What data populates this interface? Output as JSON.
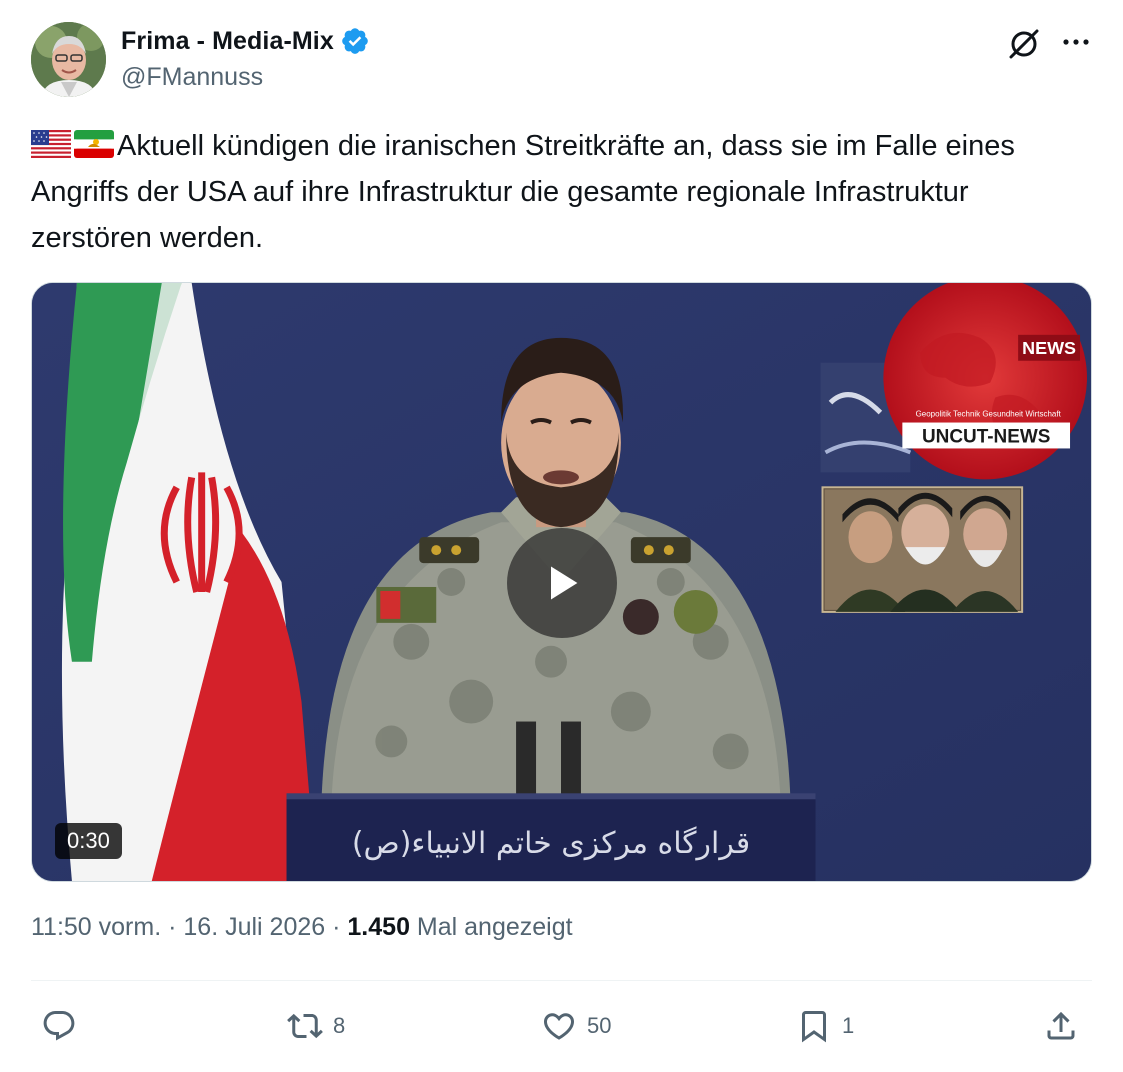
{
  "author": {
    "display_name": "Frima - Media-Mix",
    "handle": "@FMannuss",
    "verified": true,
    "verified_color": "#1d9bf0"
  },
  "header_icons": {
    "grok": "grok-icon",
    "more": "more-icon"
  },
  "tweet": {
    "flags": [
      "us-flag-icon",
      "iran-lion-sun-flag-icon"
    ],
    "text": "Aktuell kündigen die iranischen Streitkräfte an, dass sie im Falle eines Angriffs der USA auf ihre Infrastruktur die gesamte regionale Infrastruktur zerstören werden."
  },
  "media": {
    "type": "video",
    "duration": "0:30",
    "overlay_logo_badge": "NEWS",
    "overlay_logo_title": "UNCUT-NEWS",
    "overlay_logo_tagline": "Geopolitik Technik Gesundheit Wirtschaft",
    "podium_text": "قرارگاه مرکزی خاتم الانبیاء(ص)"
  },
  "meta": {
    "time": "11:50 vorm.",
    "separator": "·",
    "date": "16. Juli 2026",
    "views_count": "1.450",
    "views_label": "Mal angezeigt"
  },
  "actions": {
    "reply": {
      "icon": "reply-icon",
      "count": ""
    },
    "repost": {
      "icon": "repost-icon",
      "count": "8"
    },
    "like": {
      "icon": "heart-icon",
      "count": "50"
    },
    "bookmark": {
      "icon": "bookmark-icon",
      "count": "1"
    },
    "share": {
      "icon": "share-icon",
      "count": ""
    }
  },
  "colors": {
    "text_primary": "#0f1419",
    "text_secondary": "#536471",
    "divider": "#eff3f4",
    "accent": "#1d9bf0"
  }
}
